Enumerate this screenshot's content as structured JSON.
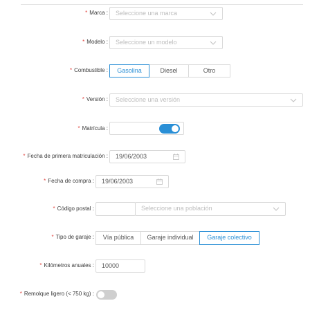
{
  "form": {
    "marca": {
      "label": "Marca",
      "required_mark": "*",
      "placeholder": "Seleccione una marca",
      "icon": "chevron-down-icon"
    },
    "modelo": {
      "label": "Modelo",
      "required_mark": "*",
      "placeholder": "Seleccione un modelo",
      "icon": "chevron-down-icon"
    },
    "combustible": {
      "label": "Combustible",
      "required_mark": "*",
      "options": [
        "Gasolina",
        "Diesel",
        "Otro"
      ],
      "selected": "Gasolina"
    },
    "version": {
      "label": "Versión",
      "required_mark": "*",
      "placeholder": "Seleccione una versión",
      "icon": "chevron-down-icon"
    },
    "matricula": {
      "label": "Matrícula",
      "required_mark": "*",
      "value": "",
      "toggle_on": true
    },
    "fecha_primera": {
      "label": "Fecha de primera matriculación",
      "required_mark": "*",
      "value": "19/06/2003",
      "icon": "calendar-icon"
    },
    "fecha_compra": {
      "label": "Fecha de compra",
      "required_mark": "*",
      "value": "19/06/2003",
      "icon": "calendar-icon"
    },
    "codigo_postal": {
      "label": "Código postal",
      "required_mark": "*",
      "value": "",
      "poblacion_placeholder": "Seleccione una población",
      "icon": "chevron-down-icon"
    },
    "tipo_garaje": {
      "label": "Tipo de garaje",
      "required_mark": "*",
      "options": [
        "Vía pública",
        "Garaje individual",
        "Garaje colectivo"
      ],
      "selected": "Garaje colectivo"
    },
    "kilometros": {
      "label": "Kilómetros anuales",
      "required_mark": "*",
      "value": "10000"
    },
    "remolque": {
      "label": "Remolque ligero (< 750 kg)",
      "required_mark": "*",
      "toggle_on": false
    }
  },
  "colors": {
    "accent": "#2a8fd6",
    "required": "#e0453f",
    "border": "#d9d9d9",
    "toggle_off": "#cfcfcf"
  },
  "label_suffix": ":"
}
